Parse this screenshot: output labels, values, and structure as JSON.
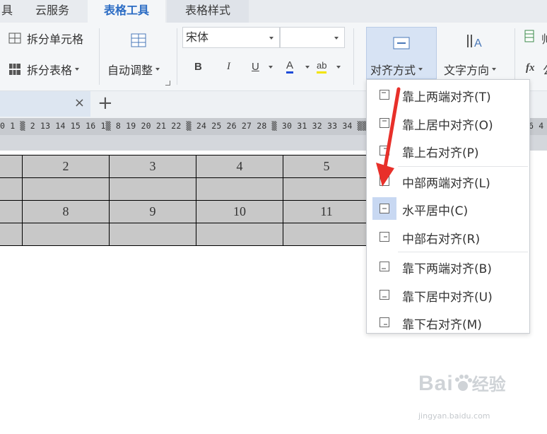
{
  "tabs": [
    "具",
    "云服务",
    "表格工具",
    "表格样式"
  ],
  "ribbon": {
    "split_cells": "拆分单元格",
    "split_table": "拆分表格",
    "autofit": "自动调整",
    "font_name": "宋体",
    "font_size": "",
    "bold": "B",
    "italic": "I",
    "underline": "U",
    "font_color": "A",
    "highlight": "ab",
    "align": "对齐方式",
    "text_direction": "文字方向",
    "right_partial_1": "帅",
    "right_partial_2": "fx",
    "right_partial_3": "公"
  },
  "doc_tab": {
    "close": "×",
    "new_tab": "+"
  },
  "ruler_text": "0 1 ▒ 2 13 14 15 16 1▒ 8 19 20 21 22 ▒ 24 25 26 27 28 ▒ 30 31 32 33 34 ▒▒▒▒▒▒▒▒▒▒▒▒▒▒▒▒▒▒▒▒▒▒▒▒▒▒▒▒▒ 4 ▒ 6 4",
  "table": {
    "rows": [
      [
        "",
        "2",
        "3",
        "4",
        "5"
      ],
      [
        "",
        "",
        "",
        "",
        ""
      ],
      [
        "",
        "8",
        "9",
        "10",
        "11"
      ],
      [
        "",
        "",
        "",
        "",
        ""
      ]
    ]
  },
  "align_menu": {
    "groups": [
      [
        "靠上两端对齐(T)",
        "靠上居中对齐(O)",
        "靠上右对齐(P)"
      ],
      [
        "中部两端对齐(L)",
        "水平居中(C)",
        "中部右对齐(R)"
      ],
      [
        "靠下两端对齐(B)",
        "靠下居中对齐(U)",
        "靠下右对齐(M)"
      ]
    ],
    "highlighted": "水平居中(C)"
  },
  "watermark": {
    "brand": "Bai",
    "brand2": "经验",
    "url": "jingyan.baidu.com"
  },
  "colors": {
    "accent": "#2b6cc4",
    "arrow": "#e8302a",
    "highlight": "#c8d8f2"
  }
}
